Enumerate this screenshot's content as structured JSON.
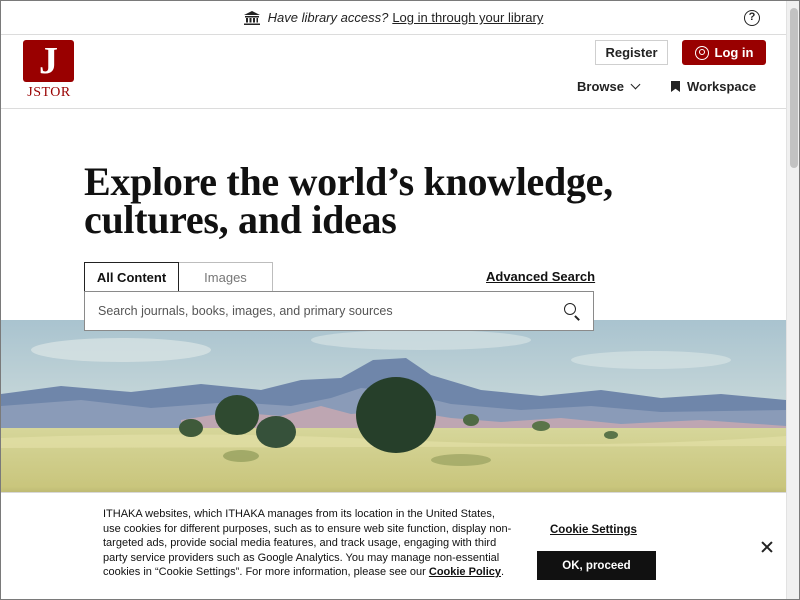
{
  "banner": {
    "question": "Have library access?",
    "link": "Log in through your library",
    "library_icon": "institution-icon",
    "help_icon": "help-circle-icon",
    "help_glyph": "?"
  },
  "header": {
    "logo_wordmark": "JSTOR",
    "logo_glyph": "J",
    "register_label": "Register",
    "login_label": "Log in",
    "browse_label": "Browse",
    "workspace_label": "Workspace",
    "brand_color": "#990000"
  },
  "hero": {
    "title_line1": "Explore the world’s knowledge,",
    "title_line2": "cultures, and ideas"
  },
  "search": {
    "tabs": [
      {
        "label": "All Content",
        "active": true
      },
      {
        "label": "Images",
        "active": false
      }
    ],
    "advanced_label": "Advanced Search",
    "placeholder": "Search journals, books, images, and primary sources"
  },
  "cookie": {
    "text": "ITHAKA websites, which ITHAKA manages from its location in the United States, use cookies for different purposes, such as to ensure web site function, display non-targeted ads, provide social media features, and track usage, engaging with third party service providers such as Google Analytics. You may manage non-essential cookies in “Cookie Settings”. For more information, please see our ",
    "policy_link": "Cookie Policy",
    "policy_suffix": ".",
    "settings_label": "Cookie Settings",
    "proceed_label": "OK, proceed"
  }
}
